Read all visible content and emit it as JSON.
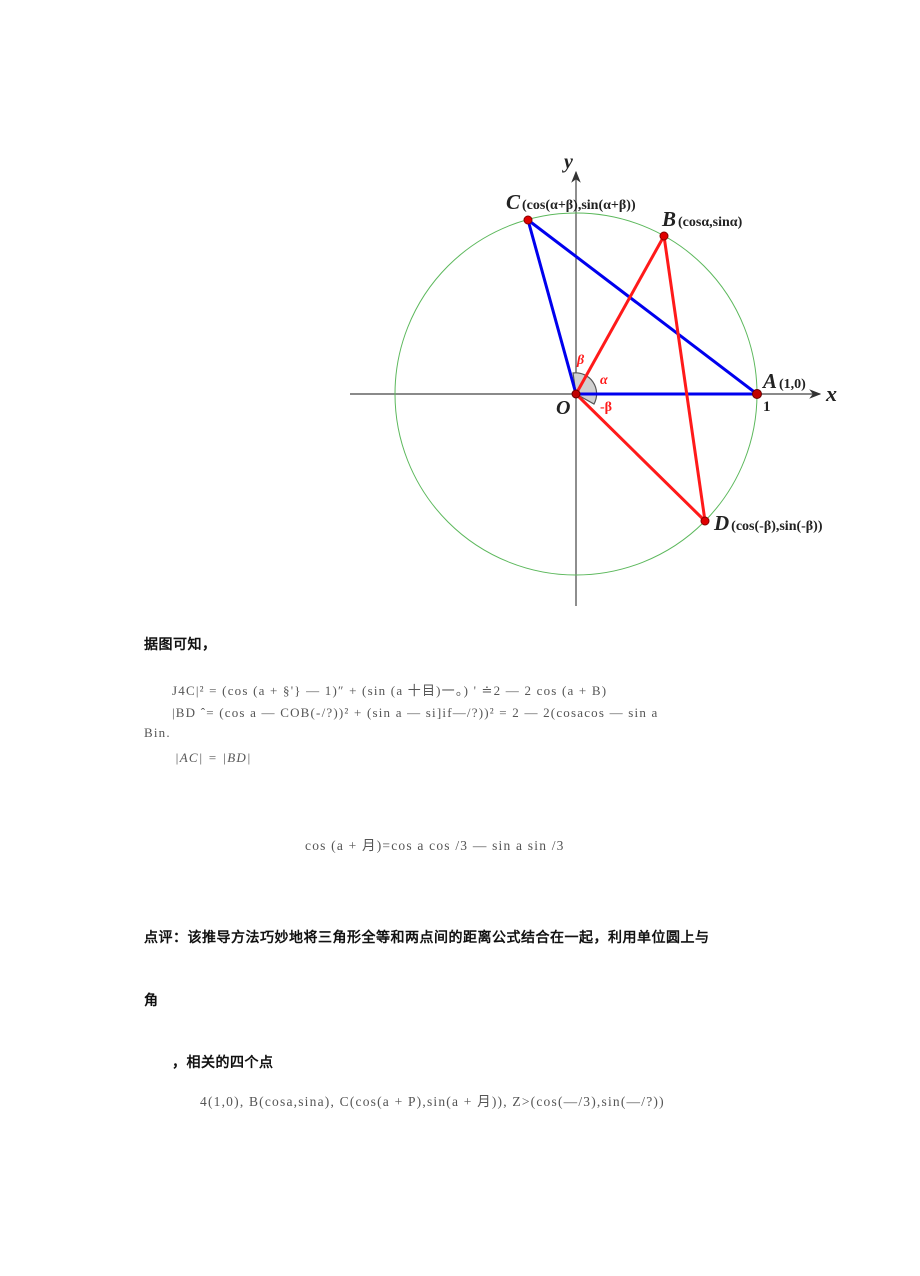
{
  "figure": {
    "axis_x_label": "x",
    "axis_y_label": "y",
    "origin_label": "O",
    "unit_tick_label": "1",
    "points": {
      "A": {
        "name": "A",
        "coords": "(1,0)"
      },
      "B": {
        "name": "B",
        "coords": "(cosα,sinα)"
      },
      "C": {
        "name": "C",
        "coords": "(cos(α+β),sin(α+β))"
      },
      "D": {
        "name": "D",
        "coords": "(cos(-β),sin(-β))"
      }
    },
    "angle_labels": {
      "beta": "β",
      "alpha": "α",
      "neg_beta": "-β"
    },
    "colors": {
      "circle": "#4caf50",
      "triangle_AOC": "#0000ee",
      "triangle_BOD": "#ff1a1a",
      "point": "#e00000",
      "axes": "#333333"
    }
  },
  "text": {
    "intro": "据图可知，",
    "eq1": "J4C|² = (cos (a + §'} — 1)″ + (sin (a 十目)一。) ' ≐2 — 2 cos (a + B)",
    "eq2": "|BD ˆ= (cos a — COB(-/?))² + (sin a — si]if—/?))² = 2 — 2(cosacos — sin a",
    "eq2_cont": "Bin.",
    "eq3": "|AC| = |BD|",
    "result": "cos (a + 月)=cos a cos /3 — sin a sin /3",
    "comment": "点评：该推导方法巧妙地将三角形全等和两点间的距离公式结合在一起，利用单位圆上与",
    "comment_cont": "角",
    "points_intro": "，相关的四个点",
    "points_list": "4(1,0), B(cosa,sina), C(cos(a + P),sin(a + 月)), Z>(cos(—/3),sin(—/?))"
  }
}
